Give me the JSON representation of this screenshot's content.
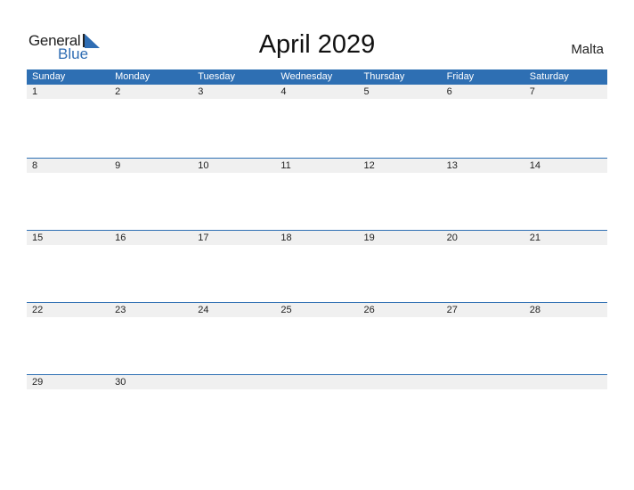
{
  "brand": {
    "word1": "General",
    "word2": "Blue",
    "color": "#2e6fb3"
  },
  "title": "April 2029",
  "country": "Malta",
  "weekdays": [
    "Sunday",
    "Monday",
    "Tuesday",
    "Wednesday",
    "Thursday",
    "Friday",
    "Saturday"
  ],
  "weeks": [
    [
      "1",
      "2",
      "3",
      "4",
      "5",
      "6",
      "7"
    ],
    [
      "8",
      "9",
      "10",
      "11",
      "12",
      "13",
      "14"
    ],
    [
      "15",
      "16",
      "17",
      "18",
      "19",
      "20",
      "21"
    ],
    [
      "22",
      "23",
      "24",
      "25",
      "26",
      "27",
      "28"
    ],
    [
      "29",
      "30",
      "",
      "",
      "",
      "",
      ""
    ]
  ]
}
